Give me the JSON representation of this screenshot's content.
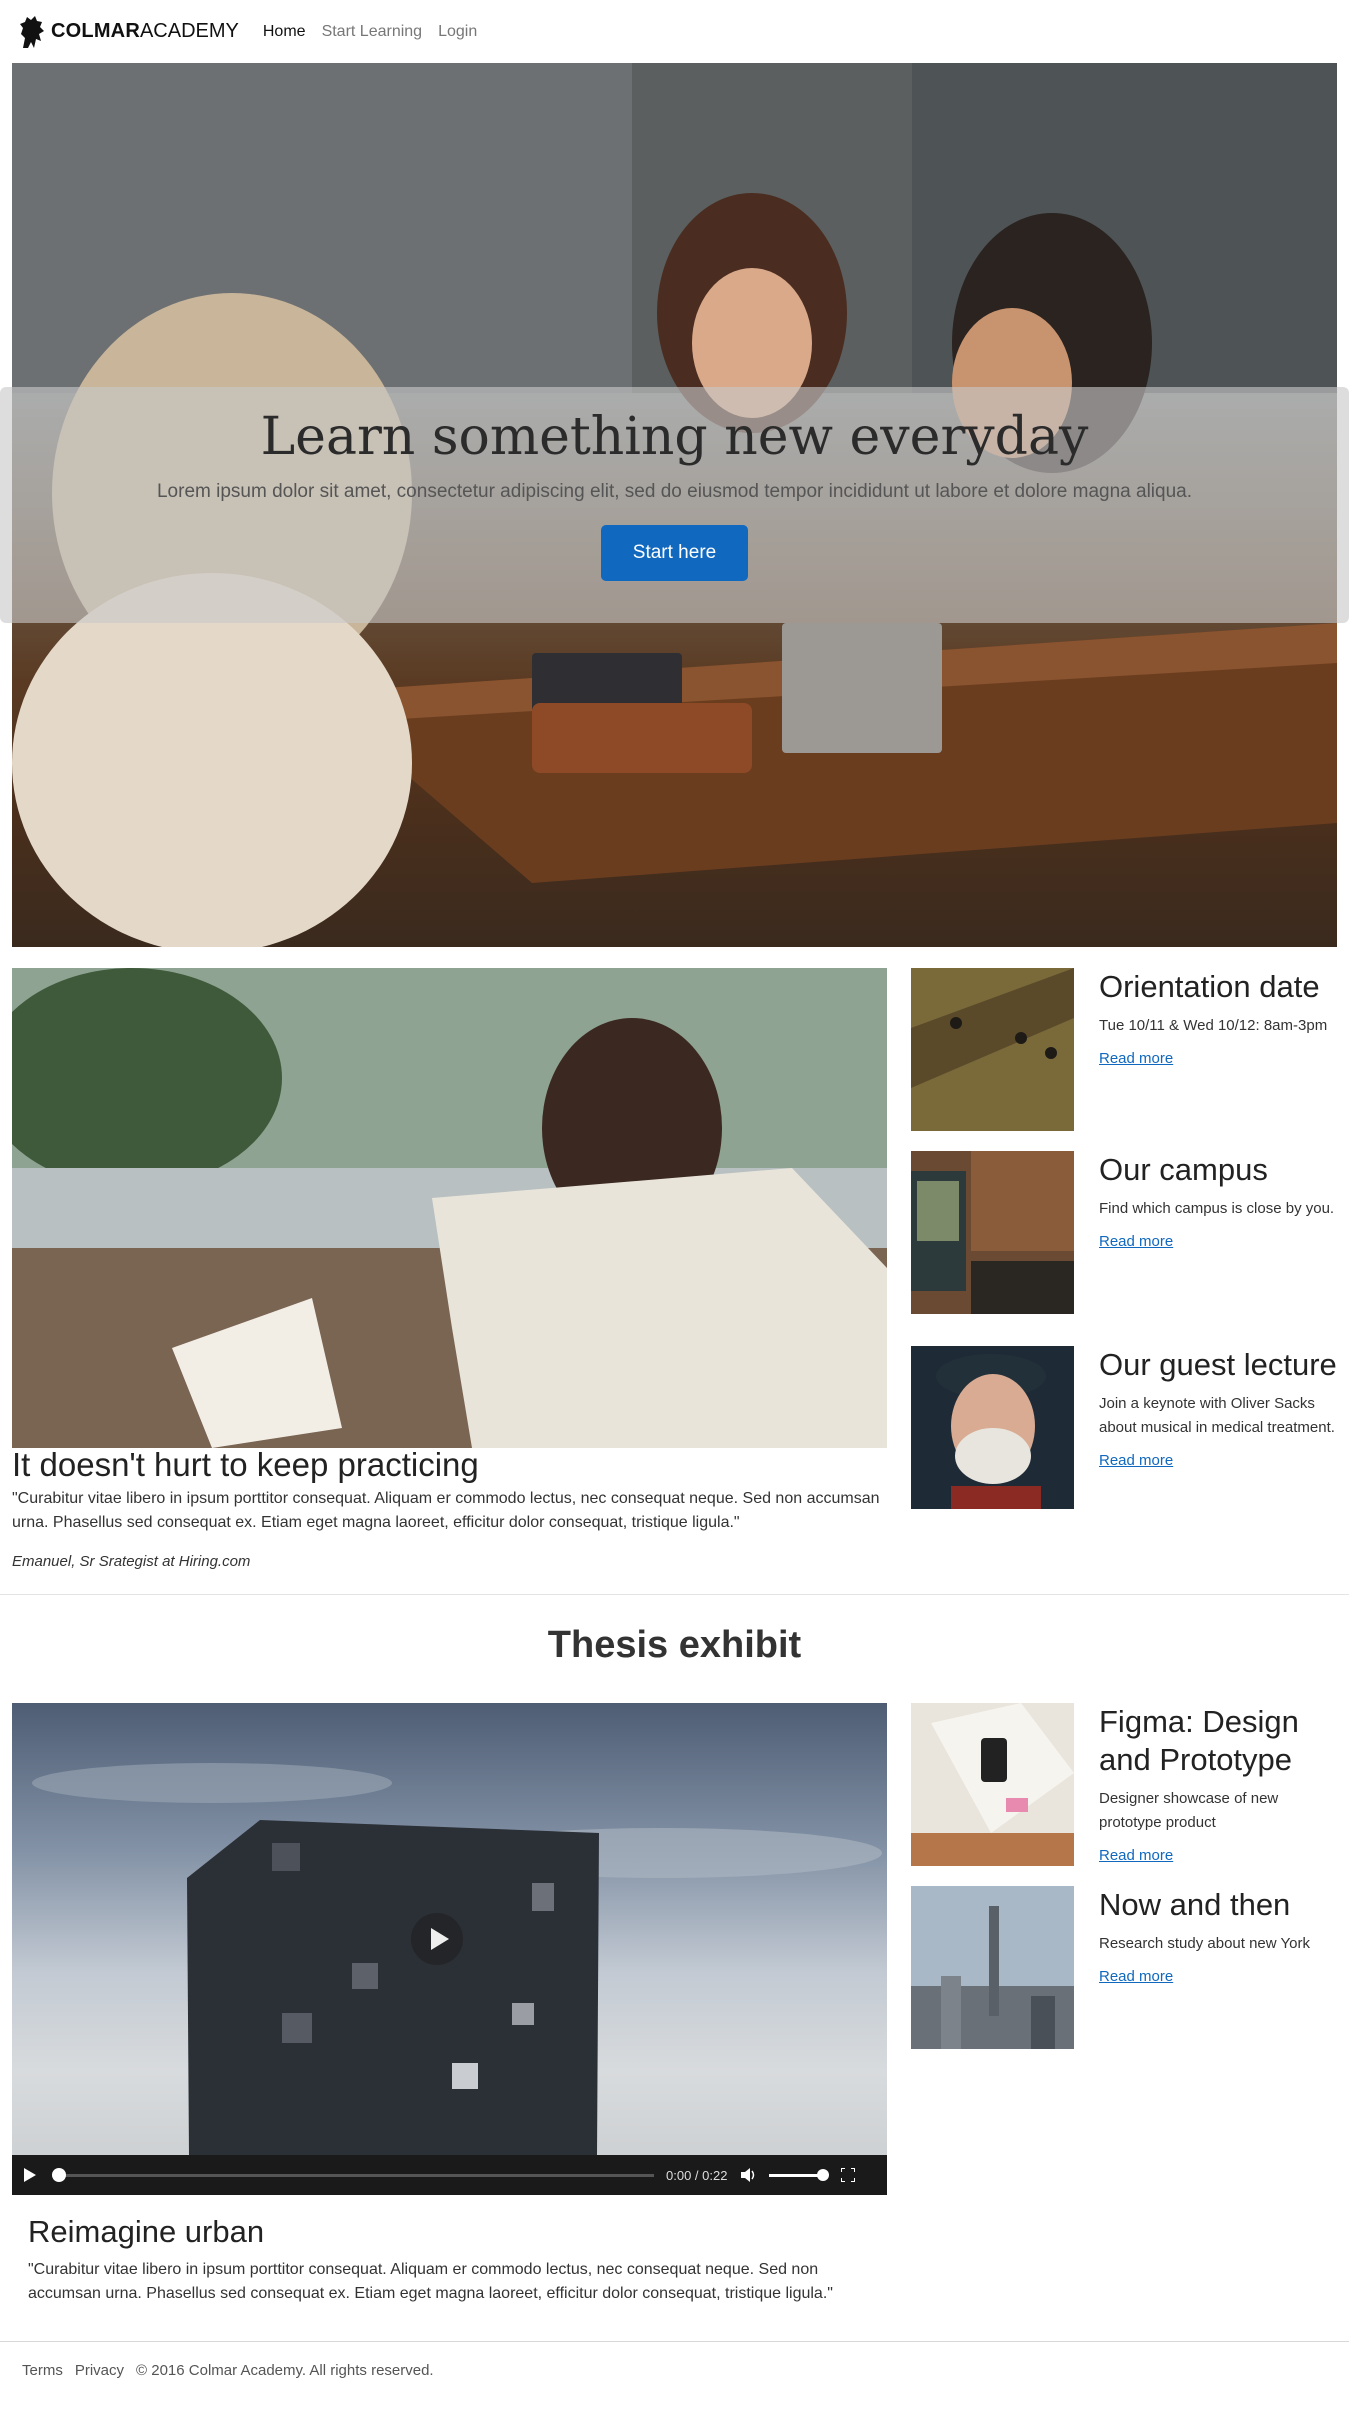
{
  "nav": {
    "brand_bold": "COLMAR",
    "brand_light": "ACADEMY",
    "links": [
      "Home",
      "Start Learning",
      "Login"
    ]
  },
  "hero": {
    "title": "Learn something new everyday",
    "subtitle": "Lorem ipsum dolor sit amet, consectetur adipiscing elit, sed do eiusmod tempor incididunt ut labore et dolore magna aliqua.",
    "button": "Start here"
  },
  "feature": {
    "title": "It doesn't hurt to keep practicing",
    "quote": "\"Curabitur vitae libero in ipsum porttitor consequat. Aliquam er commodo lectus, nec consequat neque. Sed non accumsan urna. Phasellus sed consequat ex. Etiam eget magna laoreet, efficitur dolor consequat, tristique ligula.\"",
    "author": "Emanuel, Sr Srategist at Hiring.com"
  },
  "side_cards": [
    {
      "title": "Orientation date",
      "text": "Tue 10/11 & Wed 10/12: 8am-3pm",
      "link": "Read more"
    },
    {
      "title": "Our campus",
      "text": "Find which campus is close by you.",
      "link": "Read more"
    },
    {
      "title": "Our guest lecture",
      "text": "Join a keynote with Oliver Sacks about musical in medical treatment.",
      "link": "Read more"
    }
  ],
  "thesis": {
    "title": "Thesis exhibit",
    "video_time": "0:00 / 0:22",
    "video_title": "Reimagine urban",
    "video_quote": "\"Curabitur vitae libero in ipsum porttitor consequat. Aliquam er commodo lectus, nec consequat neque. Sed non accumsan urna. Phasellus sed consequat ex. Etiam eget magna laoreet, efficitur dolor consequat, tristique ligula.\"",
    "cards": [
      {
        "title": "Figma: Design and Prototype",
        "text": "Designer showcase of new prototype product",
        "link": "Read more"
      },
      {
        "title": "Now and then",
        "text": "Research study about new York",
        "link": "Read more"
      }
    ]
  },
  "footer": {
    "terms": "Terms",
    "privacy": "Privacy",
    "copyright": "© 2016 Colmar Academy. All rights reserved."
  },
  "colors": {
    "primary": "#1068bf",
    "link": "#1068bf"
  }
}
